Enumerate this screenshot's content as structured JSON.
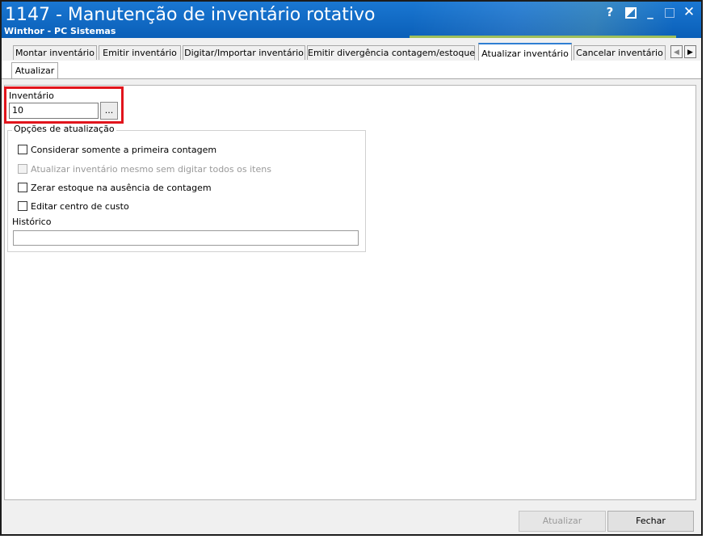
{
  "window": {
    "title": "1147 - Manutenção de inventário rotativo",
    "subtitle": "Winthor - PC Sistemas",
    "controls": {
      "help": "?",
      "minimize": "_",
      "close": "✕"
    }
  },
  "tabs": [
    {
      "label": "Montar inventário"
    },
    {
      "label": "Emitir inventário"
    },
    {
      "label": "Digitar/Importar inventário"
    },
    {
      "label": "Emitir divergência contagem/estoque"
    },
    {
      "label": "Atualizar inventário"
    },
    {
      "label": "Cancelar inventário"
    }
  ],
  "tab_nav": {
    "prev": "◀",
    "next": "▶"
  },
  "subtab": {
    "label": "Atualizar"
  },
  "inventario": {
    "label": "Inventário",
    "value": "10",
    "browse_label": "..."
  },
  "options": {
    "title": "Opções de atualização",
    "items": [
      {
        "label": "Considerar somente a primeira contagem",
        "checked": false,
        "enabled": true
      },
      {
        "label": "Atualizar inventário mesmo sem digitar todos os itens",
        "checked": false,
        "enabled": false
      },
      {
        "label": "Zerar estoque na ausência de contagem",
        "checked": false,
        "enabled": true
      },
      {
        "label": "Editar centro de custo",
        "checked": false,
        "enabled": true
      }
    ]
  },
  "historico": {
    "label": "Histórico",
    "value": ""
  },
  "buttons": {
    "update": "Atualizar",
    "close": "Fechar"
  },
  "colors": {
    "titlebar": "#0a5fb8",
    "highlight": "#e1141c",
    "active_tab_accent": "#2f7fd3"
  }
}
